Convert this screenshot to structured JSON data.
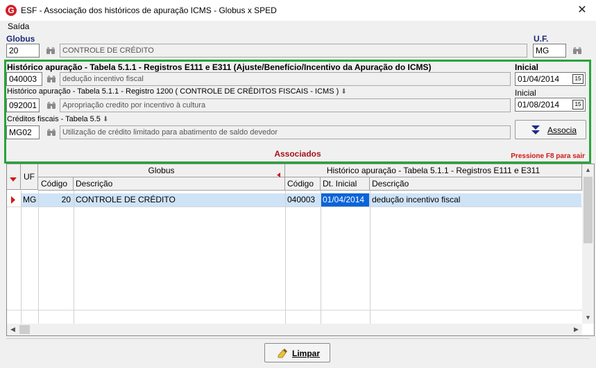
{
  "window": {
    "title": "ESF - Associação dos históricos de apuração ICMS - Globus x SPED",
    "close_glyph": "✕",
    "app_icon_letter": "G"
  },
  "menu": {
    "saida": "Saída"
  },
  "globus": {
    "label": "Globus",
    "code": "20",
    "description": "CONTROLE DE CRÉDITO"
  },
  "uf": {
    "label": "U.F.",
    "value": "MG"
  },
  "hist_e111": {
    "label": "Histórico apuração - Tabela 5.1.1 - Registros E111 e E311 (Ajuste/Benefício/Incentivo da Apuração do ICMS)",
    "code": "040003",
    "description": "dedução incentivo fiscal",
    "date_label": "Inicial",
    "date": "01/04/2014"
  },
  "hist_1200": {
    "label": "Histórico apuração - Tabela 5.1.1 - Registro 1200 ( CONTROLE DE CRÉDITOS FISCAIS - ICMS )",
    "code": "092001",
    "description": "Apropriação credito por incentivo à cultura",
    "date_label": "Inicial",
    "date": "01/08/2014"
  },
  "creditos": {
    "label": "Créditos fiscais - Tabela 5.5",
    "code": "MG02",
    "description": "Utilização de crédito limitado para abatimento de saldo devedor"
  },
  "buttons": {
    "associa": "Associa",
    "limpar": "Limpar"
  },
  "associados": {
    "title": "Associados",
    "hint": "Pressione F8 para sair"
  },
  "grid": {
    "group_globus": "Globus",
    "group_hist": "Histórico apuração - Tabela 5.1.1 - Registros E111 e E311",
    "columns": {
      "uf": "UF",
      "codigo": "Código",
      "descricao": "Descrição",
      "codigo2": "Código",
      "dt_inicial": "Dt. Inicial",
      "descricao2": "Descrição"
    },
    "rows": [
      {
        "uf": "MG",
        "codigo": "20",
        "descricao": "CONTROLE DE CRÉDITO",
        "codigo2": "040003",
        "dt_inicial": "01/04/2014",
        "descricao2": "dedução incentivo fiscal"
      }
    ]
  },
  "colors": {
    "frame_green": "#27a43a",
    "associados_red": "#a5121c",
    "selection": "#cfe3f7",
    "date_highlight": "#0a64d8"
  }
}
